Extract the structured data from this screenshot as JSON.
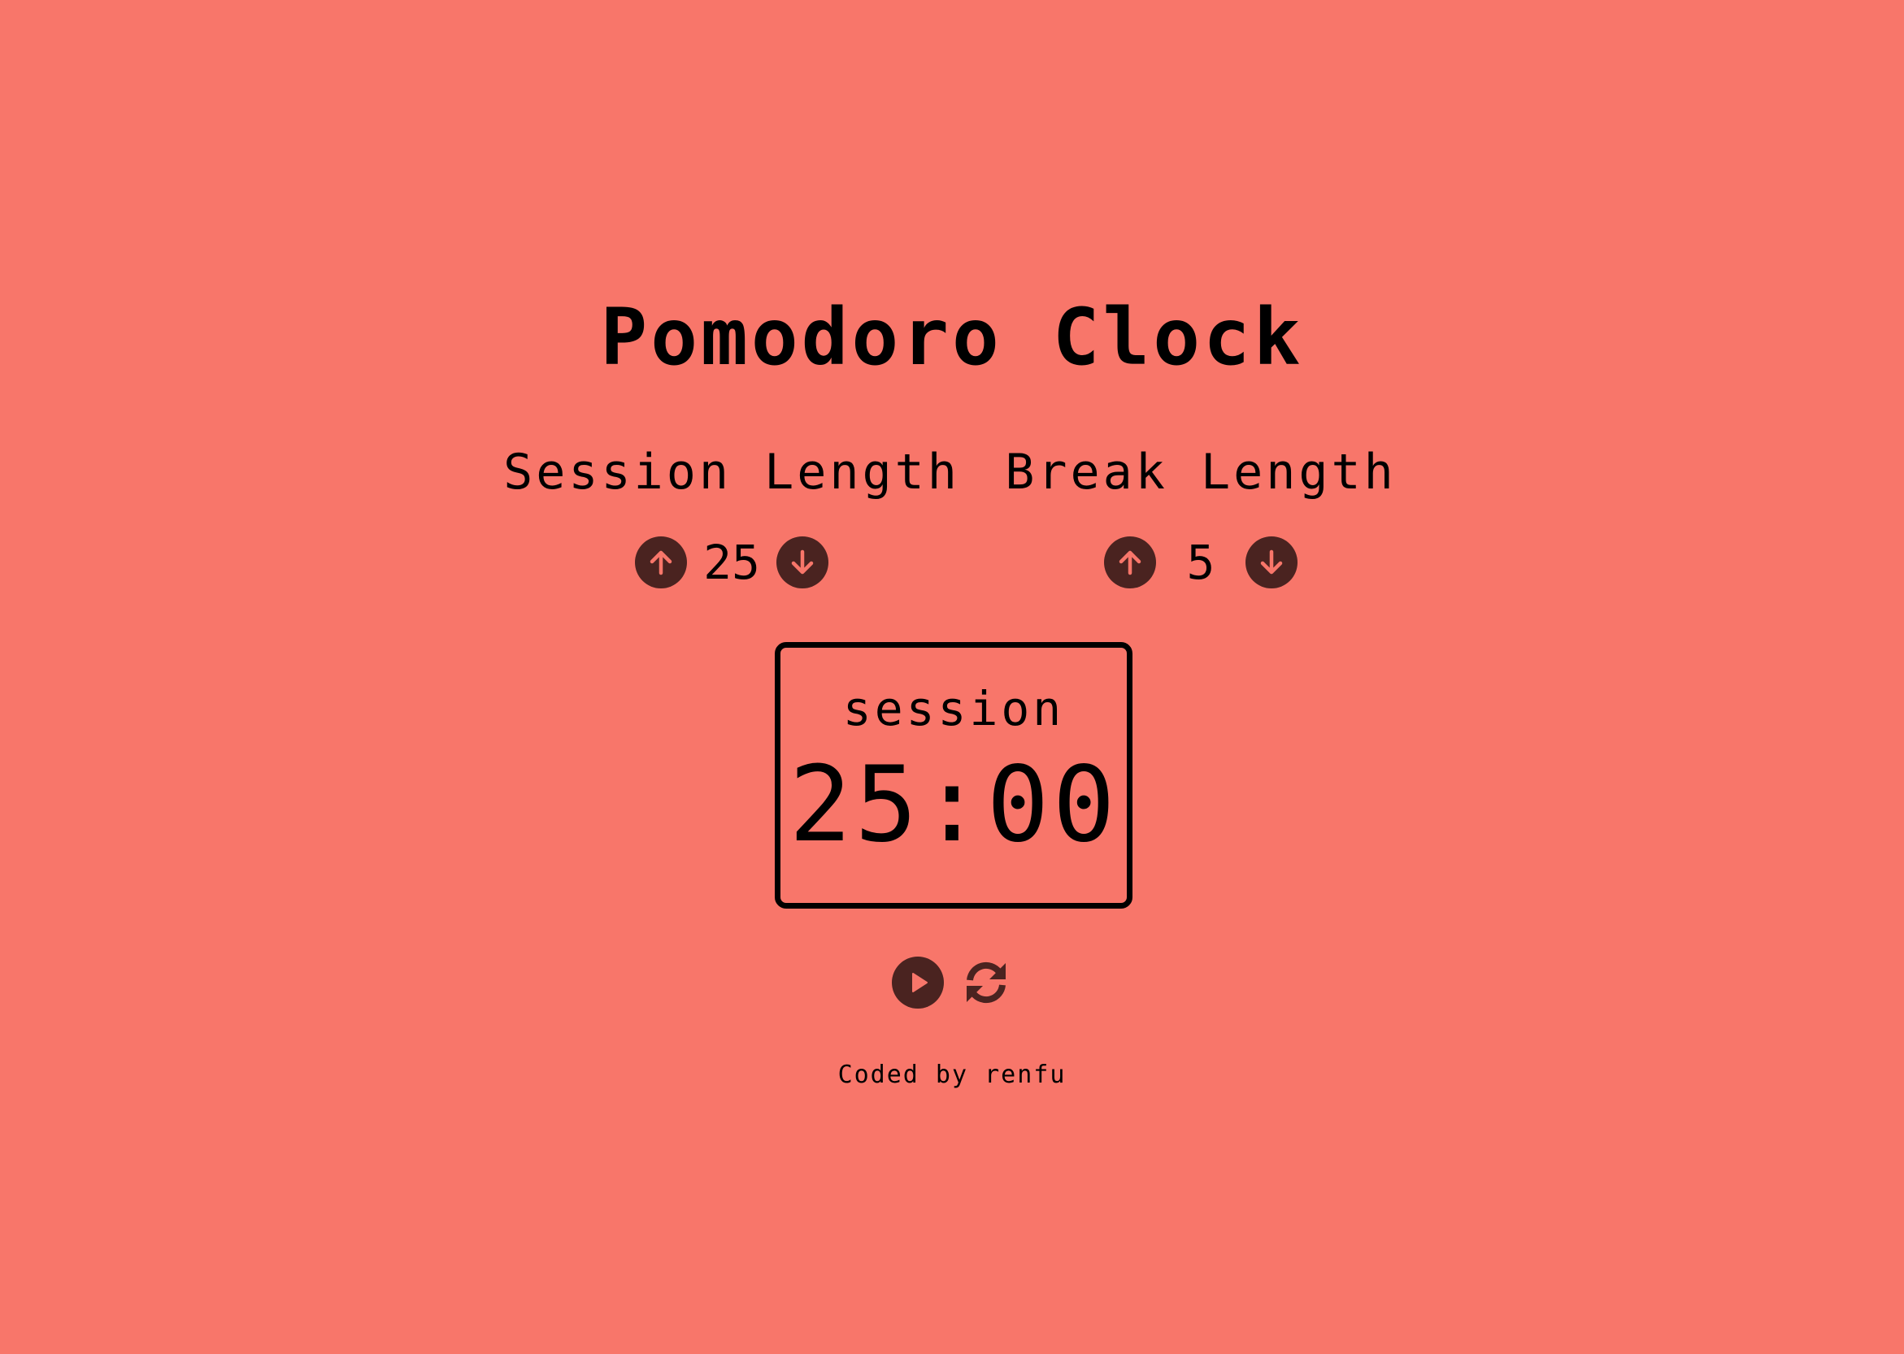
{
  "app": {
    "title": "Pomodoro Clock"
  },
  "controls": {
    "session": {
      "label": "Session Length",
      "value": "25",
      "increment_icon": "arrow-up-circle-icon",
      "decrement_icon": "arrow-down-circle-icon"
    },
    "break": {
      "label": "Break Length",
      "value": "5",
      "increment_icon": "arrow-up-circle-icon",
      "decrement_icon": "arrow-down-circle-icon"
    }
  },
  "timer": {
    "label": "session",
    "display": "25:00"
  },
  "playback": {
    "play_icon": "play-circle-icon",
    "reset_icon": "refresh-icon"
  },
  "footer": {
    "credit": "Coded by renfu"
  },
  "colors": {
    "background": "#F8766A",
    "button": "#4A2320",
    "text": "#000000"
  }
}
